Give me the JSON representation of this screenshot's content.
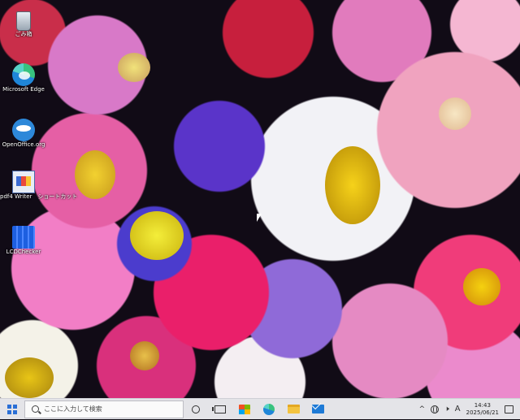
{
  "desktop": {
    "icons": [
      {
        "label": "ごみ箱",
        "icon": "recycle-bin-icon"
      },
      {
        "label": "Microsoft Edge",
        "icon": "edge-icon"
      },
      {
        "label": "OpenOffice.org",
        "icon": "openoffice-icon"
      },
      {
        "label": "pdf4 Writer　ショートカット",
        "icon": "pdf-shortcut-icon"
      },
      {
        "label": "LCDChecker",
        "icon": "lcd-checker-icon"
      }
    ]
  },
  "taskbar": {
    "search_placeholder": "ここに入力して検索",
    "apps": [
      "cortana-icon",
      "task-view-icon",
      "store-icon",
      "edge-icon",
      "file-explorer-icon",
      "mail-icon"
    ],
    "tray": {
      "chevron": "^",
      "speaker": "🕨",
      "ime": "A",
      "time": "14:43",
      "date": "2025/06/21"
    }
  },
  "colors": {
    "taskbar_bg": "#e4e4e8",
    "accent": "#2a6fd6"
  }
}
